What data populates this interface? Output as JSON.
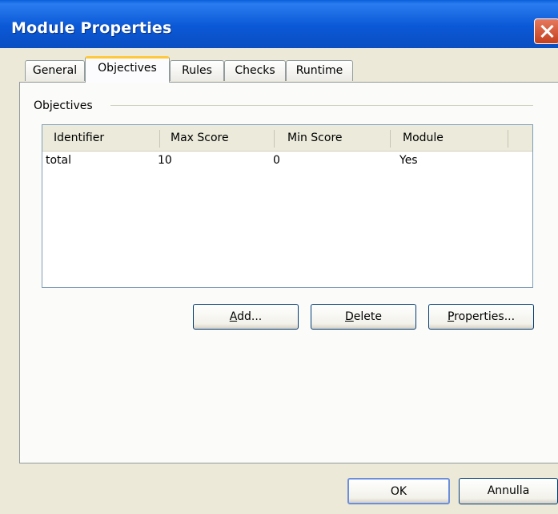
{
  "window": {
    "title": "Module Properties"
  },
  "tabs": [
    {
      "label": "General",
      "active": false
    },
    {
      "label": "Objectives",
      "active": true
    },
    {
      "label": "Rules",
      "active": false
    },
    {
      "label": "Checks",
      "active": false
    },
    {
      "label": "Runtime",
      "active": false
    }
  ],
  "objectives": {
    "group_label": "Objectives",
    "columns": [
      "Identifier",
      "Max Score",
      "Min Score",
      "Module"
    ],
    "rows": [
      [
        "total",
        "10",
        "0",
        "Yes"
      ]
    ],
    "buttons": {
      "add_mnemonic": "A",
      "add_rest": "dd...",
      "delete_mnemonic": "D",
      "delete_rest": "elete",
      "properties_mnemonic": "P",
      "properties_rest": "roperties..."
    }
  },
  "footer": {
    "ok": "OK",
    "cancel": "Annulla"
  },
  "colors": {
    "titlebar": "#0a58d6",
    "accent": "#ffc83c",
    "close": "#c4401f"
  }
}
